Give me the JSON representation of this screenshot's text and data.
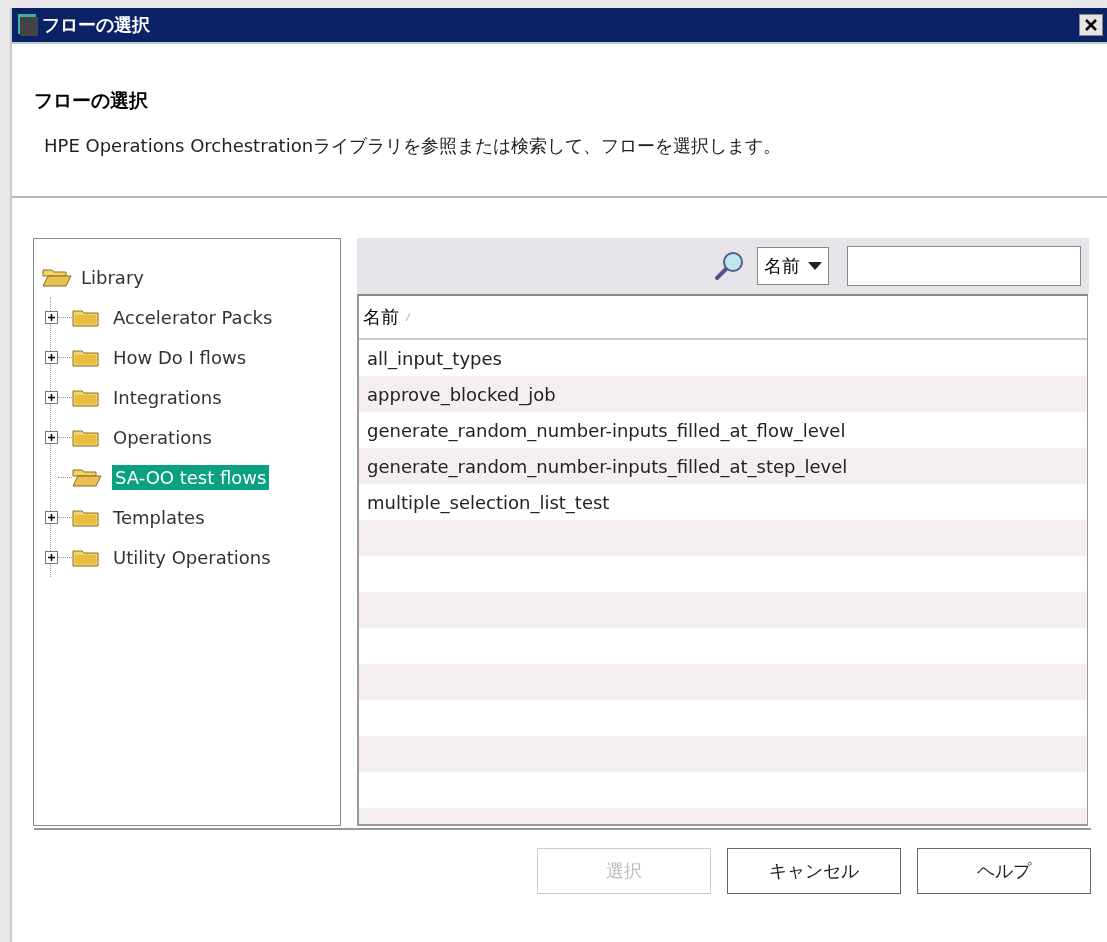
{
  "window": {
    "title": "フローの選択"
  },
  "header": {
    "heading": "フローの選択",
    "description": "HPE Operations Orchestrationライブラリを参照または検索して、フローを選択します。"
  },
  "tree": {
    "label": "Library",
    "expanded": true,
    "selected": false,
    "children": [
      {
        "label": "Accelerator Packs",
        "expandable": true,
        "selected": false
      },
      {
        "label": "How Do I flows",
        "expandable": true,
        "selected": false
      },
      {
        "label": "Integrations",
        "expandable": true,
        "selected": false
      },
      {
        "label": "Operations",
        "expandable": true,
        "selected": false
      },
      {
        "label": "SA-OO test flows",
        "expandable": false,
        "selected": true
      },
      {
        "label": "Templates",
        "expandable": true,
        "selected": false
      },
      {
        "label": "Utility Operations",
        "expandable": true,
        "selected": false
      }
    ]
  },
  "search": {
    "field_dropdown": "名前"
  },
  "table": {
    "columns": [
      "名前"
    ],
    "rows": [
      "all_input_types",
      "approve_blocked_job",
      "generate_random_number-inputs_filled_at_flow_level",
      "generate_random_number-inputs_filled_at_step_level",
      "multiple_selection_list_test"
    ]
  },
  "buttons": [
    {
      "label": "選択",
      "disabled": true
    },
    {
      "label": "キャンセル",
      "disabled": false
    },
    {
      "label": "ヘルプ",
      "disabled": false
    }
  ]
}
